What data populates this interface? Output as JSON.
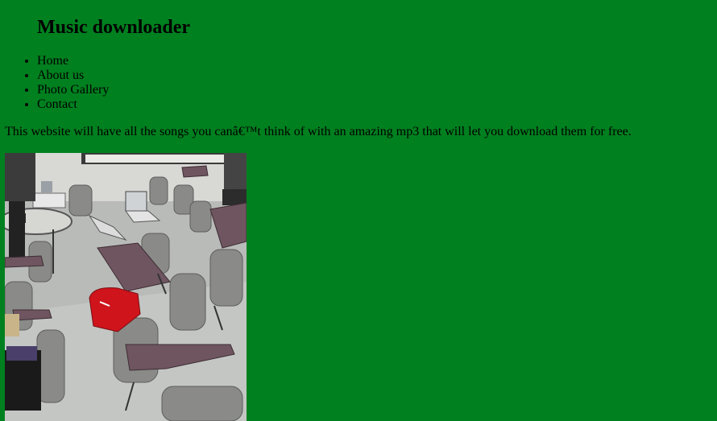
{
  "header": {
    "title": "Music downloader"
  },
  "nav": {
    "items": [
      {
        "label": "Home"
      },
      {
        "label": "About us"
      },
      {
        "label": "Photo Gallery"
      },
      {
        "label": "Contact"
      }
    ]
  },
  "main": {
    "intro_text": "This website will have all the songs you canâ€™t think of with an amazing mp3 that will let you download them for free."
  },
  "colors": {
    "page_background": "#00801f",
    "text": "#000000"
  }
}
